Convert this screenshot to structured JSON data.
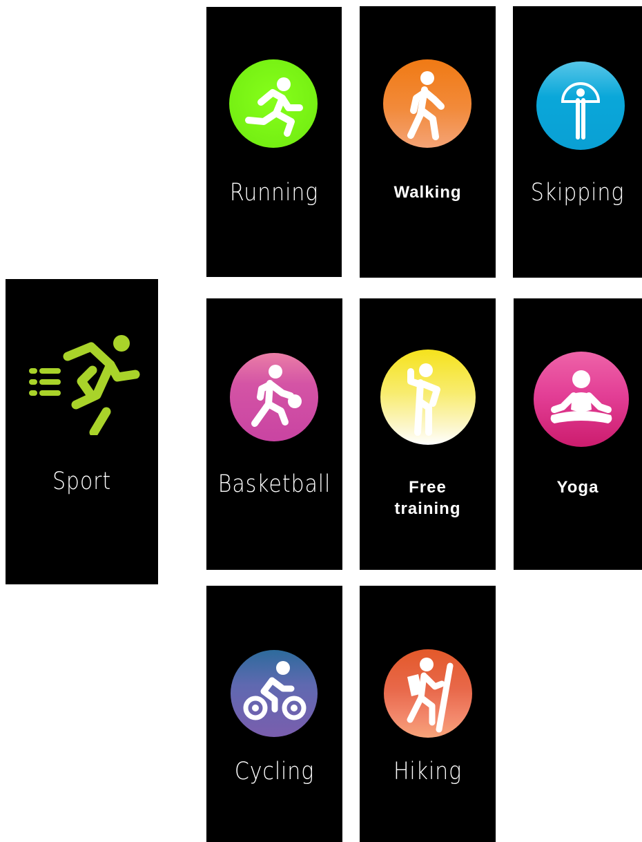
{
  "screens": {
    "sport": {
      "label": "Sport",
      "icon": "sprinter-icon",
      "accent": "#a9d32a"
    },
    "running": {
      "label": "Running",
      "icon": "running-icon",
      "color": "#78f214"
    },
    "walking": {
      "label": "Walking",
      "icon": "walking-icon",
      "color": "#f07a14"
    },
    "skipping": {
      "label": "Skipping",
      "icon": "skipping-icon",
      "color": "#0aa7d9"
    },
    "basketball": {
      "label": "Basketball",
      "icon": "basketball-icon",
      "color": "#d454a5"
    },
    "free_training": {
      "label_line1": "Free",
      "label_line2": "training",
      "icon": "free-training-icon",
      "color": "#f5e21c"
    },
    "yoga": {
      "label": "Yoga",
      "icon": "yoga-icon",
      "color": "#e33f96"
    },
    "cycling": {
      "label": "Cycling",
      "icon": "cycling-icon",
      "color": "#6b62ae"
    },
    "hiking": {
      "label": "Hiking",
      "icon": "hiking-icon",
      "color": "#e8684a"
    }
  }
}
